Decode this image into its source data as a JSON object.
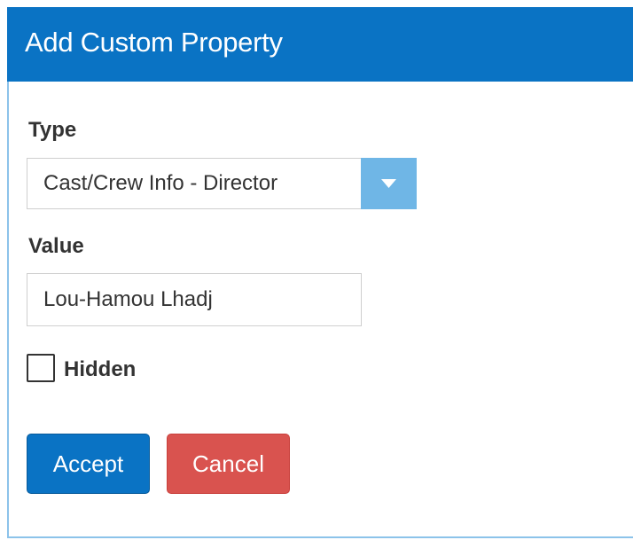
{
  "dialog": {
    "title": "Add Custom Property"
  },
  "form": {
    "type_label": "Type",
    "type_selected": "Cast/Crew Info - Director",
    "value_label": "Value",
    "value_input": "Lou-Hamou Lhadj",
    "hidden_label": "Hidden",
    "hidden_checked": false
  },
  "buttons": {
    "accept_label": "Accept",
    "cancel_label": "Cancel"
  },
  "colors": {
    "header": "#0a73c4",
    "select_arrow": "#6fb6e6",
    "accept": "#0a73c4",
    "cancel": "#d9534f"
  },
  "icons": {
    "select_arrow": "caret-down-icon"
  }
}
